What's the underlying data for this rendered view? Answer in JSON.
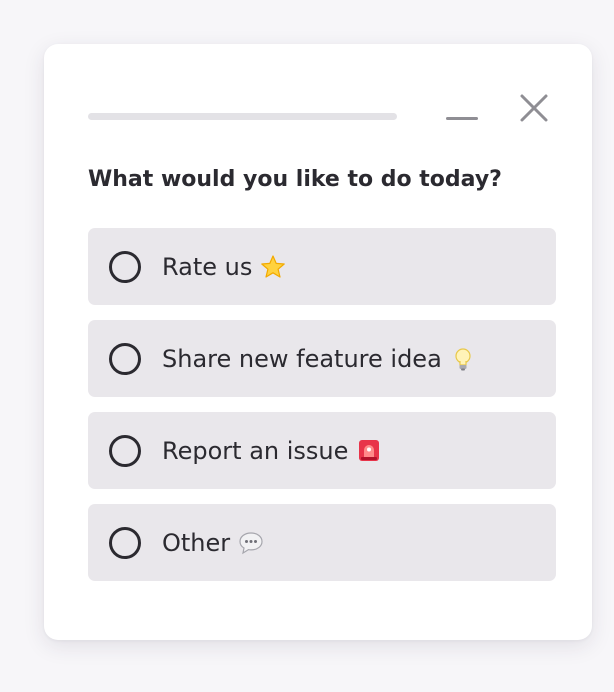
{
  "survey": {
    "progress": 0,
    "question": "What would you like to do today?",
    "options": [
      {
        "label": "Rate us",
        "icon": "star-icon"
      },
      {
        "label": "Share new feature idea",
        "icon": "lightbulb-icon"
      },
      {
        "label": "Report an issue",
        "icon": "siren-icon"
      },
      {
        "label": "Other",
        "icon": "speech-bubble-icon"
      }
    ]
  },
  "colors": {
    "page_background": "#f7f6f9",
    "card_background": "#ffffff",
    "option_background": "#e9e7eb",
    "text": "#2b2a30",
    "controls": "#8f8e94"
  }
}
